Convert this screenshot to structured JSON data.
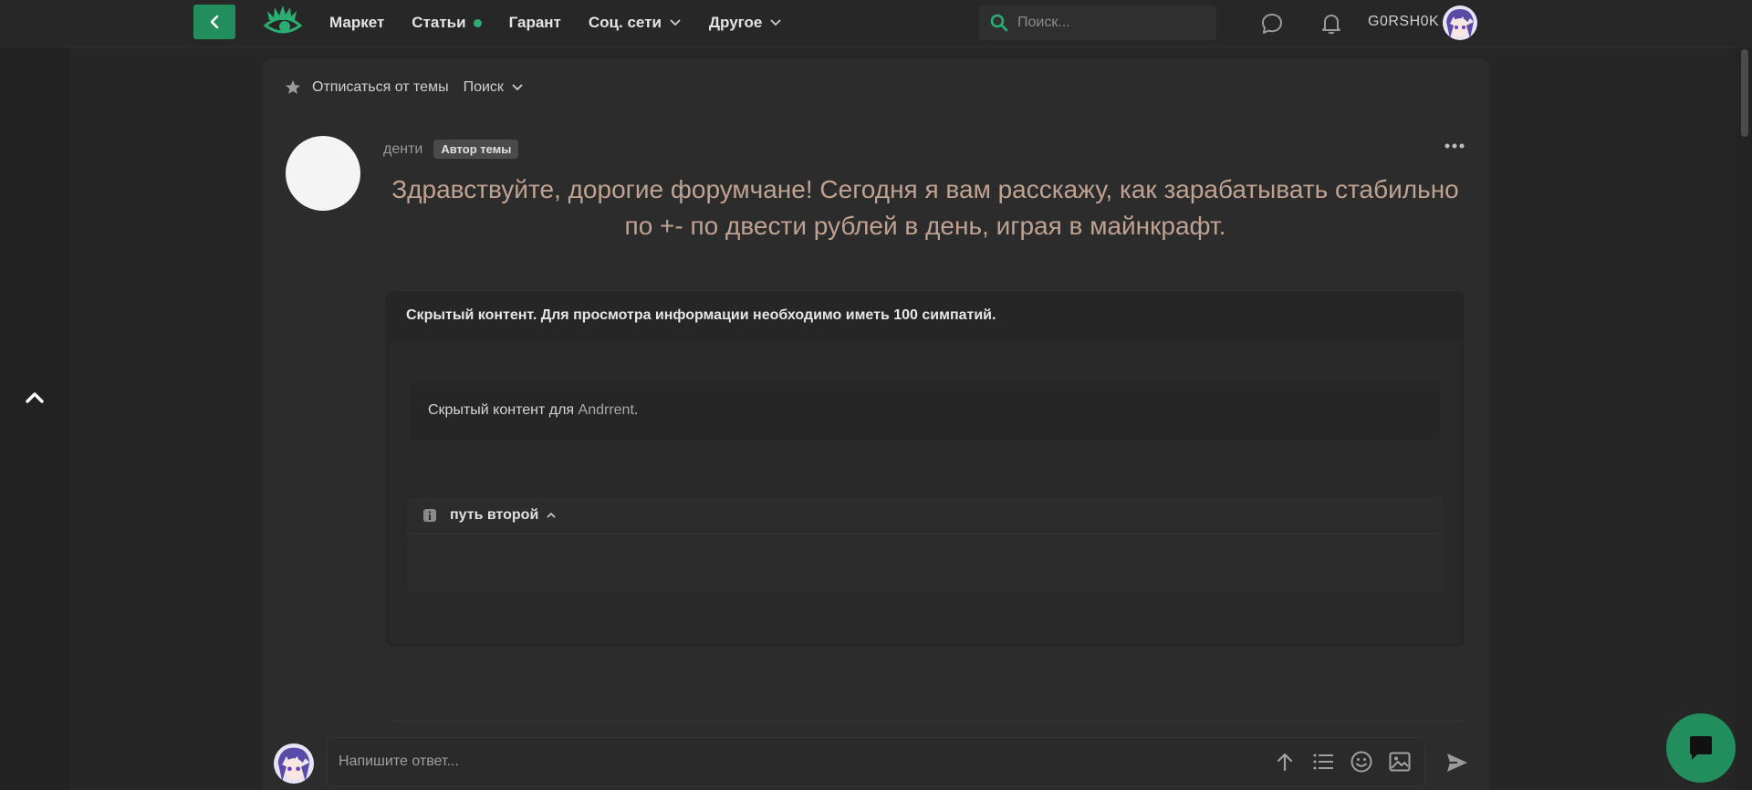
{
  "nav": {
    "items": [
      {
        "label": "Маркет",
        "has_dot": false,
        "has_chevron": false
      },
      {
        "label": "Статьи",
        "has_dot": true,
        "has_chevron": false
      },
      {
        "label": "Гарант",
        "has_dot": false,
        "has_chevron": false
      },
      {
        "label": "Соц. сети",
        "has_dot": false,
        "has_chevron": true
      },
      {
        "label": "Другое",
        "has_dot": false,
        "has_chevron": true
      }
    ],
    "search_placeholder": "Поиск...",
    "username": "G0RSH0K"
  },
  "thread_bar": {
    "unsubscribe_label": "Отписаться от темы",
    "search_label": "Поиск"
  },
  "post": {
    "author": "денти",
    "author_badge": "Автор темы",
    "text": "Здравствуйте, дорогие форумчане! Сегодня я вам расскажу, как зарабатывать стабильно по +- по двести рублей в день, играя в майнкрафт.",
    "hidden_title": "Скрытый контент. Для просмотра информации необходимо иметь 100 симпатий.",
    "hidden_for_prefix": "Скрытый контент для ",
    "hidden_for_user": "Andrrent",
    "hidden_for_suffix": ".",
    "spoiler_title": "путь второй"
  },
  "reply": {
    "placeholder": "Напишите ответ..."
  },
  "colors": {
    "accent": "#228e5d",
    "post_text": "#bfa291",
    "background": "#222222",
    "card": "#2c2c2c"
  },
  "icons": [
    "back-arrow-icon",
    "eye-logo-icon",
    "search-icon",
    "chat-bubble-icon",
    "bell-icon",
    "star-icon",
    "more-dots-icon",
    "info-icon",
    "chevron-up-icon",
    "upload-arrow-icon",
    "list-icon",
    "emoji-icon",
    "image-icon",
    "send-icon",
    "chat-fab-icon"
  ]
}
